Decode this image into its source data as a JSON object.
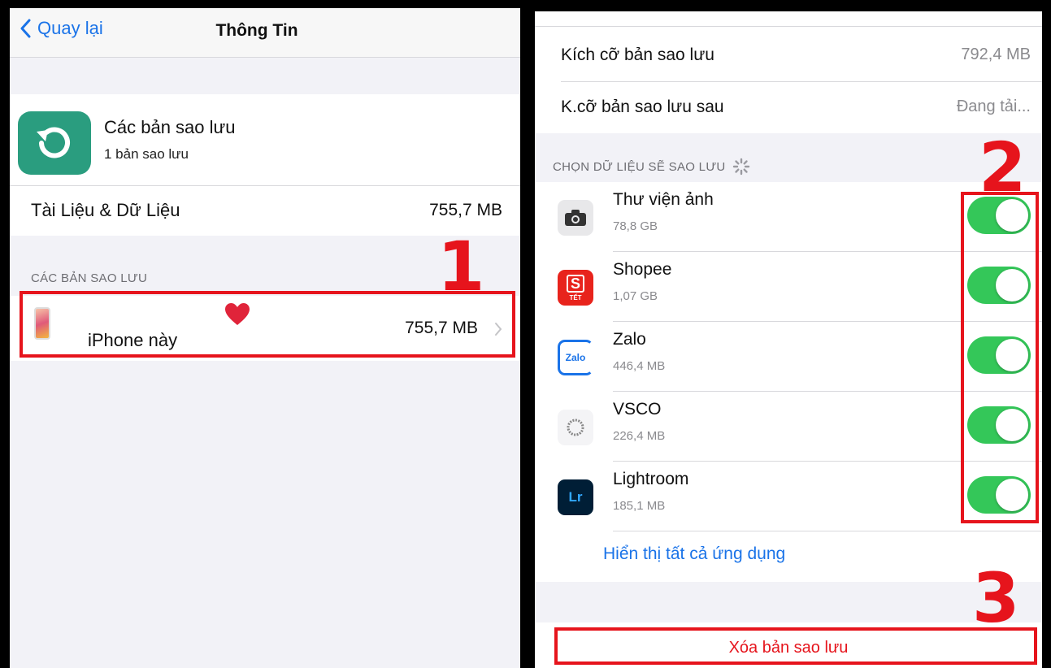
{
  "left": {
    "nav": {
      "back_label": "Quay lại",
      "title": "Thông Tin"
    },
    "backup_app": {
      "title": "Các bản sao lưu",
      "subtitle": "1 bản sao lưu"
    },
    "docs_data": {
      "label": "Tài Liệu & Dữ Liệu",
      "value": "755,7 MB"
    },
    "section_header": "CÁC BẢN SAO LƯU",
    "device_row": {
      "label": "iPhone này",
      "value": "755,7 MB"
    },
    "annotation_number": "1"
  },
  "right": {
    "size_rows": [
      {
        "label": "Kích cỡ bản sao lưu",
        "value": "792,4 MB"
      },
      {
        "label": "K.cỡ bản sao lưu sau",
        "value": "Đang tải..."
      }
    ],
    "section_header": "CHỌN DỮ LIỆU SẼ SAO LƯU",
    "apps": [
      {
        "name": "Thư viện ảnh",
        "size": "78,8 GB",
        "icon": "camera-icon",
        "enabled": true
      },
      {
        "name": "Shopee",
        "size": "1,07 GB",
        "icon": "shopee-icon",
        "enabled": true
      },
      {
        "name": "Zalo",
        "size": "446,4 MB",
        "icon": "zalo-icon",
        "enabled": true
      },
      {
        "name": "VSCO",
        "size": "226,4 MB",
        "icon": "vsco-icon",
        "enabled": true
      },
      {
        "name": "Lightroom",
        "size": "185,1 MB",
        "icon": "lightroom-icon",
        "enabled": true
      }
    ],
    "icon_text": {
      "shopee": "S",
      "shopee_tet": "TẾT",
      "zalo": "Zalo",
      "lightroom": "Lr"
    },
    "show_all_link": "Hiển thị tất cả ứng dụng",
    "delete_button": "Xóa bản sao lưu",
    "annotation_numbers": [
      "2",
      "3"
    ]
  },
  "colors": {
    "accent_blue": "#1a73e8",
    "toggle_green": "#34c759",
    "annotation_red": "#e6141c",
    "delete_red": "#e6141c"
  }
}
